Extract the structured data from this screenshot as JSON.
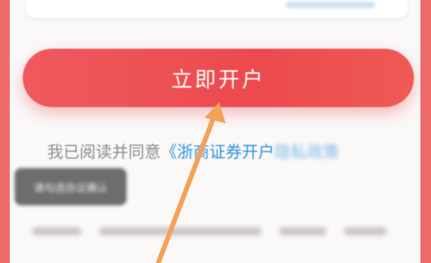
{
  "open_account_button": {
    "label": "立即开户"
  },
  "agreement": {
    "prefix": "我已阅读并同意",
    "link": "《浙商证券开户",
    "link_faded": "隐私政策"
  },
  "tooltip": {
    "text": "请勾选协议确认"
  },
  "colors": {
    "primary_red": "#ec4a4e",
    "link_blue": "#2d92de",
    "annotation_arrow": "#f4a259"
  },
  "icons": {
    "annotation": "arrow-up-icon"
  }
}
